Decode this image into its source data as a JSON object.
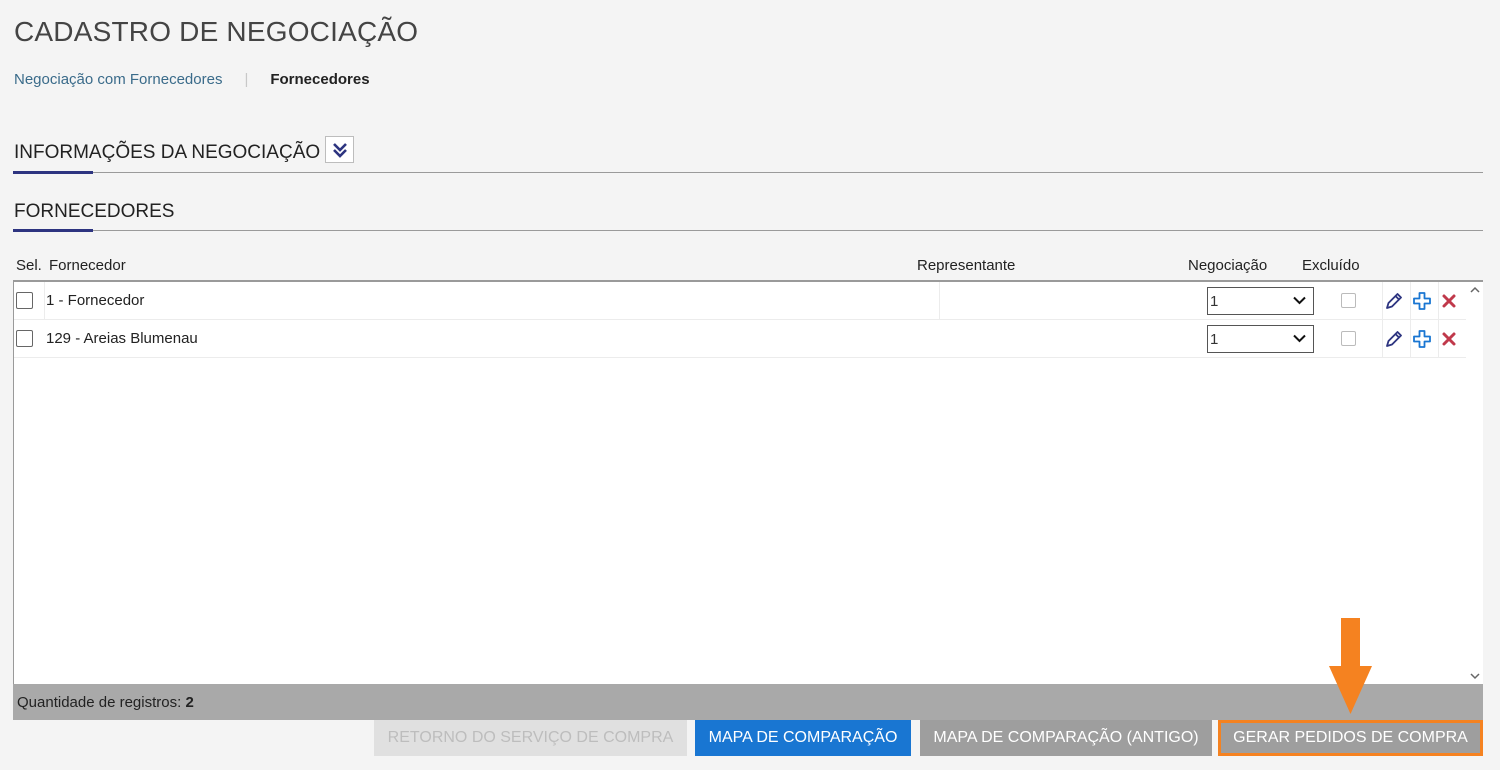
{
  "page": {
    "title": "CADASTRO DE NEGOCIAÇÃO"
  },
  "breadcrumb": {
    "link": "Negociação com Fornecedores",
    "separator": "|",
    "current": "Fornecedores"
  },
  "sections": {
    "info": {
      "title": "INFORMAÇÕES DA NEGOCIAÇÃO",
      "toggle_icon": "double-chevron-down-icon"
    },
    "fornecedores": {
      "title": "FORNECEDORES"
    }
  },
  "grid": {
    "columns": {
      "sel": "Sel.",
      "fornecedor": "Fornecedor",
      "representante": "Representante",
      "negociacao": "Negociação",
      "excluido": "Excluído"
    },
    "rows": [
      {
        "fornecedor": "1 - Fornecedor",
        "representante": "",
        "negociacao": "1",
        "excluido": false
      },
      {
        "fornecedor": "129 - Areias Blumenau",
        "representante": "",
        "negociacao": "1",
        "excluido": false
      }
    ],
    "row_actions": [
      "pencil-icon",
      "plus-icon",
      "close-icon"
    ],
    "footer": {
      "label": "Quantidade de registros:",
      "count": "2"
    }
  },
  "buttons": {
    "retorno": "RETORNO DO SERVIÇO DE COMPRA",
    "mapa": "MAPA DE COMPARAÇÃO",
    "mapa_antigo": "MAPA DE COMPARAÇÃO (ANTIGO)",
    "gerar": "GERAR PEDIDOS DE COMPRA"
  },
  "colors": {
    "accent_navy": "#2d3480",
    "primary_blue": "#1976d2",
    "highlight_orange": "#f58220",
    "delete_red": "#c0394b"
  }
}
